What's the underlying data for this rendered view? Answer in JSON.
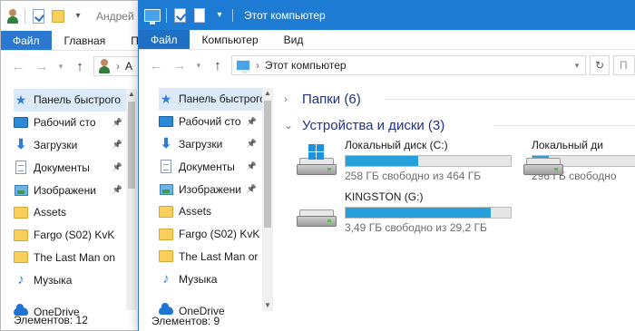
{
  "back_window": {
    "title": "Андрей",
    "ribbon_tabs": [
      "Файл",
      "Главная",
      "По"
    ],
    "address_path": "А",
    "nav_items": [
      {
        "label": "Панель быстрого",
        "icon": "star-icon",
        "pinned": false,
        "selected": true
      },
      {
        "label": "Рабочий сто",
        "icon": "desktop-icon",
        "pinned": true
      },
      {
        "label": "Загрузки",
        "icon": "download-icon",
        "pinned": true
      },
      {
        "label": "Документы",
        "icon": "documents-icon",
        "pinned": true
      },
      {
        "label": "Изображени",
        "icon": "pictures-icon",
        "pinned": true
      },
      {
        "label": "Assets",
        "icon": "folder-icon",
        "pinned": false
      },
      {
        "label": "Fargo (S02) KvK",
        "icon": "folder-icon",
        "pinned": false
      },
      {
        "label": "The Last Man on",
        "icon": "folder-icon",
        "pinned": false
      },
      {
        "label": "Музыка",
        "icon": "music-icon",
        "pinned": false
      },
      {
        "label": "",
        "icon": "",
        "pinned": false
      },
      {
        "label": "OneDrive",
        "icon": "onedrive-icon",
        "pinned": false
      }
    ],
    "status_text": "Элементов: 12"
  },
  "front_window": {
    "title": "Этот компьютер",
    "ribbon_tabs": [
      "Файл",
      "Компьютер",
      "Вид"
    ],
    "address_path": "Этот компьютер",
    "search_placeholder": "П",
    "nav_items": [
      {
        "label": "Панель быстрого",
        "icon": "star-icon",
        "pinned": false,
        "selected": true
      },
      {
        "label": "Рабочий сто",
        "icon": "desktop-icon",
        "pinned": true
      },
      {
        "label": "Загрузки",
        "icon": "download-icon",
        "pinned": true
      },
      {
        "label": "Документы",
        "icon": "documents-icon",
        "pinned": true
      },
      {
        "label": "Изображени",
        "icon": "pictures-icon",
        "pinned": true
      },
      {
        "label": "Assets",
        "icon": "folder-icon",
        "pinned": false
      },
      {
        "label": "Fargo (S02) KvK",
        "icon": "folder-icon",
        "pinned": false
      },
      {
        "label": "The Last Man or",
        "icon": "folder-icon",
        "pinned": false
      },
      {
        "label": "Музыка",
        "icon": "music-icon",
        "pinned": false
      },
      {
        "label": "",
        "icon": "",
        "pinned": false
      },
      {
        "label": "OneDrive",
        "icon": "onedrive-icon",
        "pinned": false
      }
    ],
    "status_text": "Элементов: 9",
    "groups": {
      "folders": "Папки (6)",
      "devices": "Устройства и диски (3)"
    },
    "drives": [
      {
        "name": "Локальный диск (C:)",
        "free_text": "258 ГБ свободно из 464 ГБ",
        "used_fraction": 0.44,
        "icon": "system-drive-icon"
      },
      {
        "name": "Локальный ди",
        "free_text": "296 ГБ свободно",
        "used_fraction": 0.1,
        "icon": "drive-icon"
      },
      {
        "name": "KINGSTON (G:)",
        "free_text": "3,49 ГБ свободно из 29,2 ГБ",
        "used_fraction": 0.88,
        "icon": "usb-drive-icon"
      }
    ]
  },
  "colors": {
    "accent": "#1e7bd4",
    "usage_bar": "#26a0da",
    "group_header": "#1e3287",
    "selection": "#dbe9f9"
  }
}
